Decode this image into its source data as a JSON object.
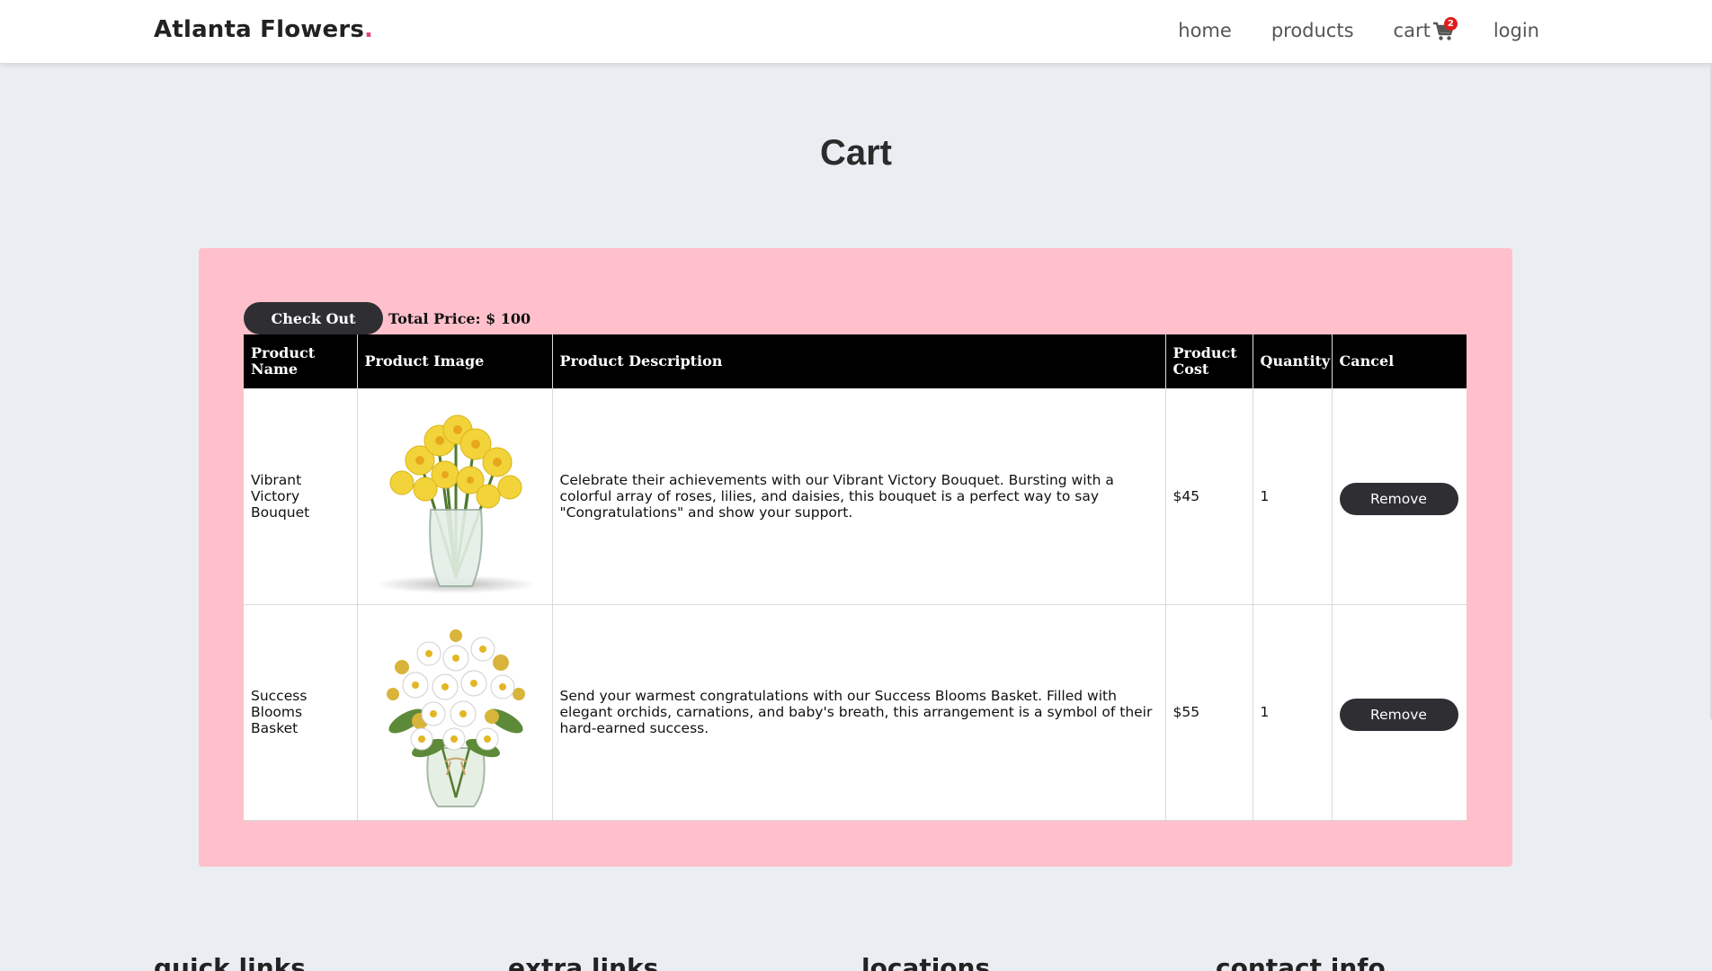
{
  "header": {
    "logo": "Atlanta Flowers",
    "logo_dot": ".",
    "nav": {
      "home": "home",
      "products": "products",
      "cart": "cart",
      "cart_count": "2",
      "login": "login"
    }
  },
  "page": {
    "title": "Cart"
  },
  "cart": {
    "checkout_label": "Check Out",
    "total_price": "Total Price: $ 100",
    "columns": [
      "Product Name",
      "Product Image",
      "Product Description",
      "Product Cost",
      "Quantity",
      "Cancel"
    ],
    "items": [
      {
        "name": "Vibrant Victory Bouquet",
        "description": "Celebrate their achievements with our Vibrant Victory Bouquet. Bursting with a colorful array of roses, lilies, and daisies, this bouquet is a perfect way to say \"Congratulations\" and show your support.",
        "cost": "$45",
        "quantity": "1",
        "remove_label": "Remove",
        "image_icon": "yellow-daffodil-vase"
      },
      {
        "name": "Success Blooms Basket",
        "description": "Send your warmest congratulations with our Success Blooms Basket. Filled with elegant orchids, carnations, and baby's breath, this arrangement is a symbol of their hard-earned success.",
        "cost": "$55",
        "quantity": "1",
        "remove_label": "Remove",
        "image_icon": "white-daisy-vase"
      }
    ]
  },
  "footer": {
    "headings": [
      "quick links",
      "extra links",
      "locations",
      "contact info"
    ]
  },
  "colors": {
    "background": "#eaeef2",
    "panel": "#ffc0cb",
    "button": "#2f2f33",
    "logo_dot": "#e0457b",
    "badge": "#e21b1b"
  }
}
